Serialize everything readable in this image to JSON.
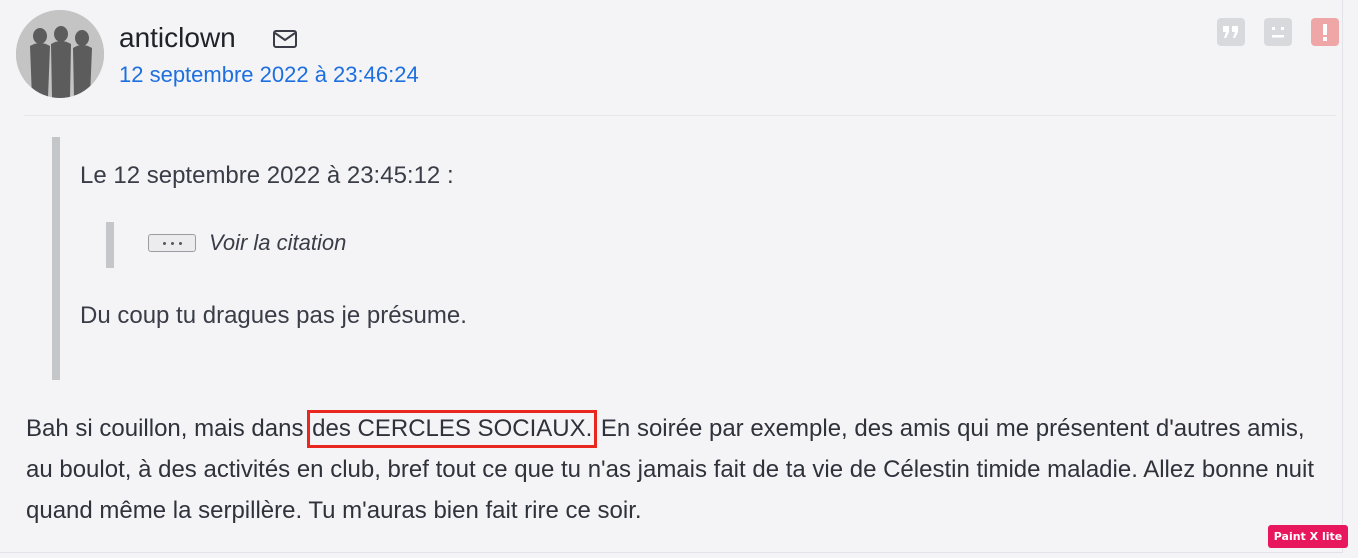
{
  "post": {
    "username": "anticlown",
    "date": "12 septembre 2022 à 23:46:24",
    "quote": {
      "header": "Le 12 septembre 2022 à 23:45:12 :",
      "nested_label": "Voir la citation",
      "text": "Du coup tu dragues pas je présume."
    },
    "body": {
      "before": "Bah si couillon, mais dans ",
      "highlighted": "des CERCLES SOCIAUX.",
      "after": " En soirée par exemple, des amis qui me présentent d'autres amis, au boulot, à des activités en club, bref tout ce que tu n'as jamais fait de ta vie de Célestin timide maladie. Allez bonne nuit quand même la serpillère. Tu m'auras bien fait rire ce soir."
    },
    "icons": {
      "mail": "mail-icon",
      "quote": "quote-icon",
      "sad": "sad-face-icon",
      "alert": "alert-icon"
    }
  },
  "watermark": "Paint X lite",
  "colors": {
    "link": "#1d6fe0",
    "highlight_box": "#e8281f",
    "alert": "#eea6a6",
    "watermark": "#e8175d"
  }
}
